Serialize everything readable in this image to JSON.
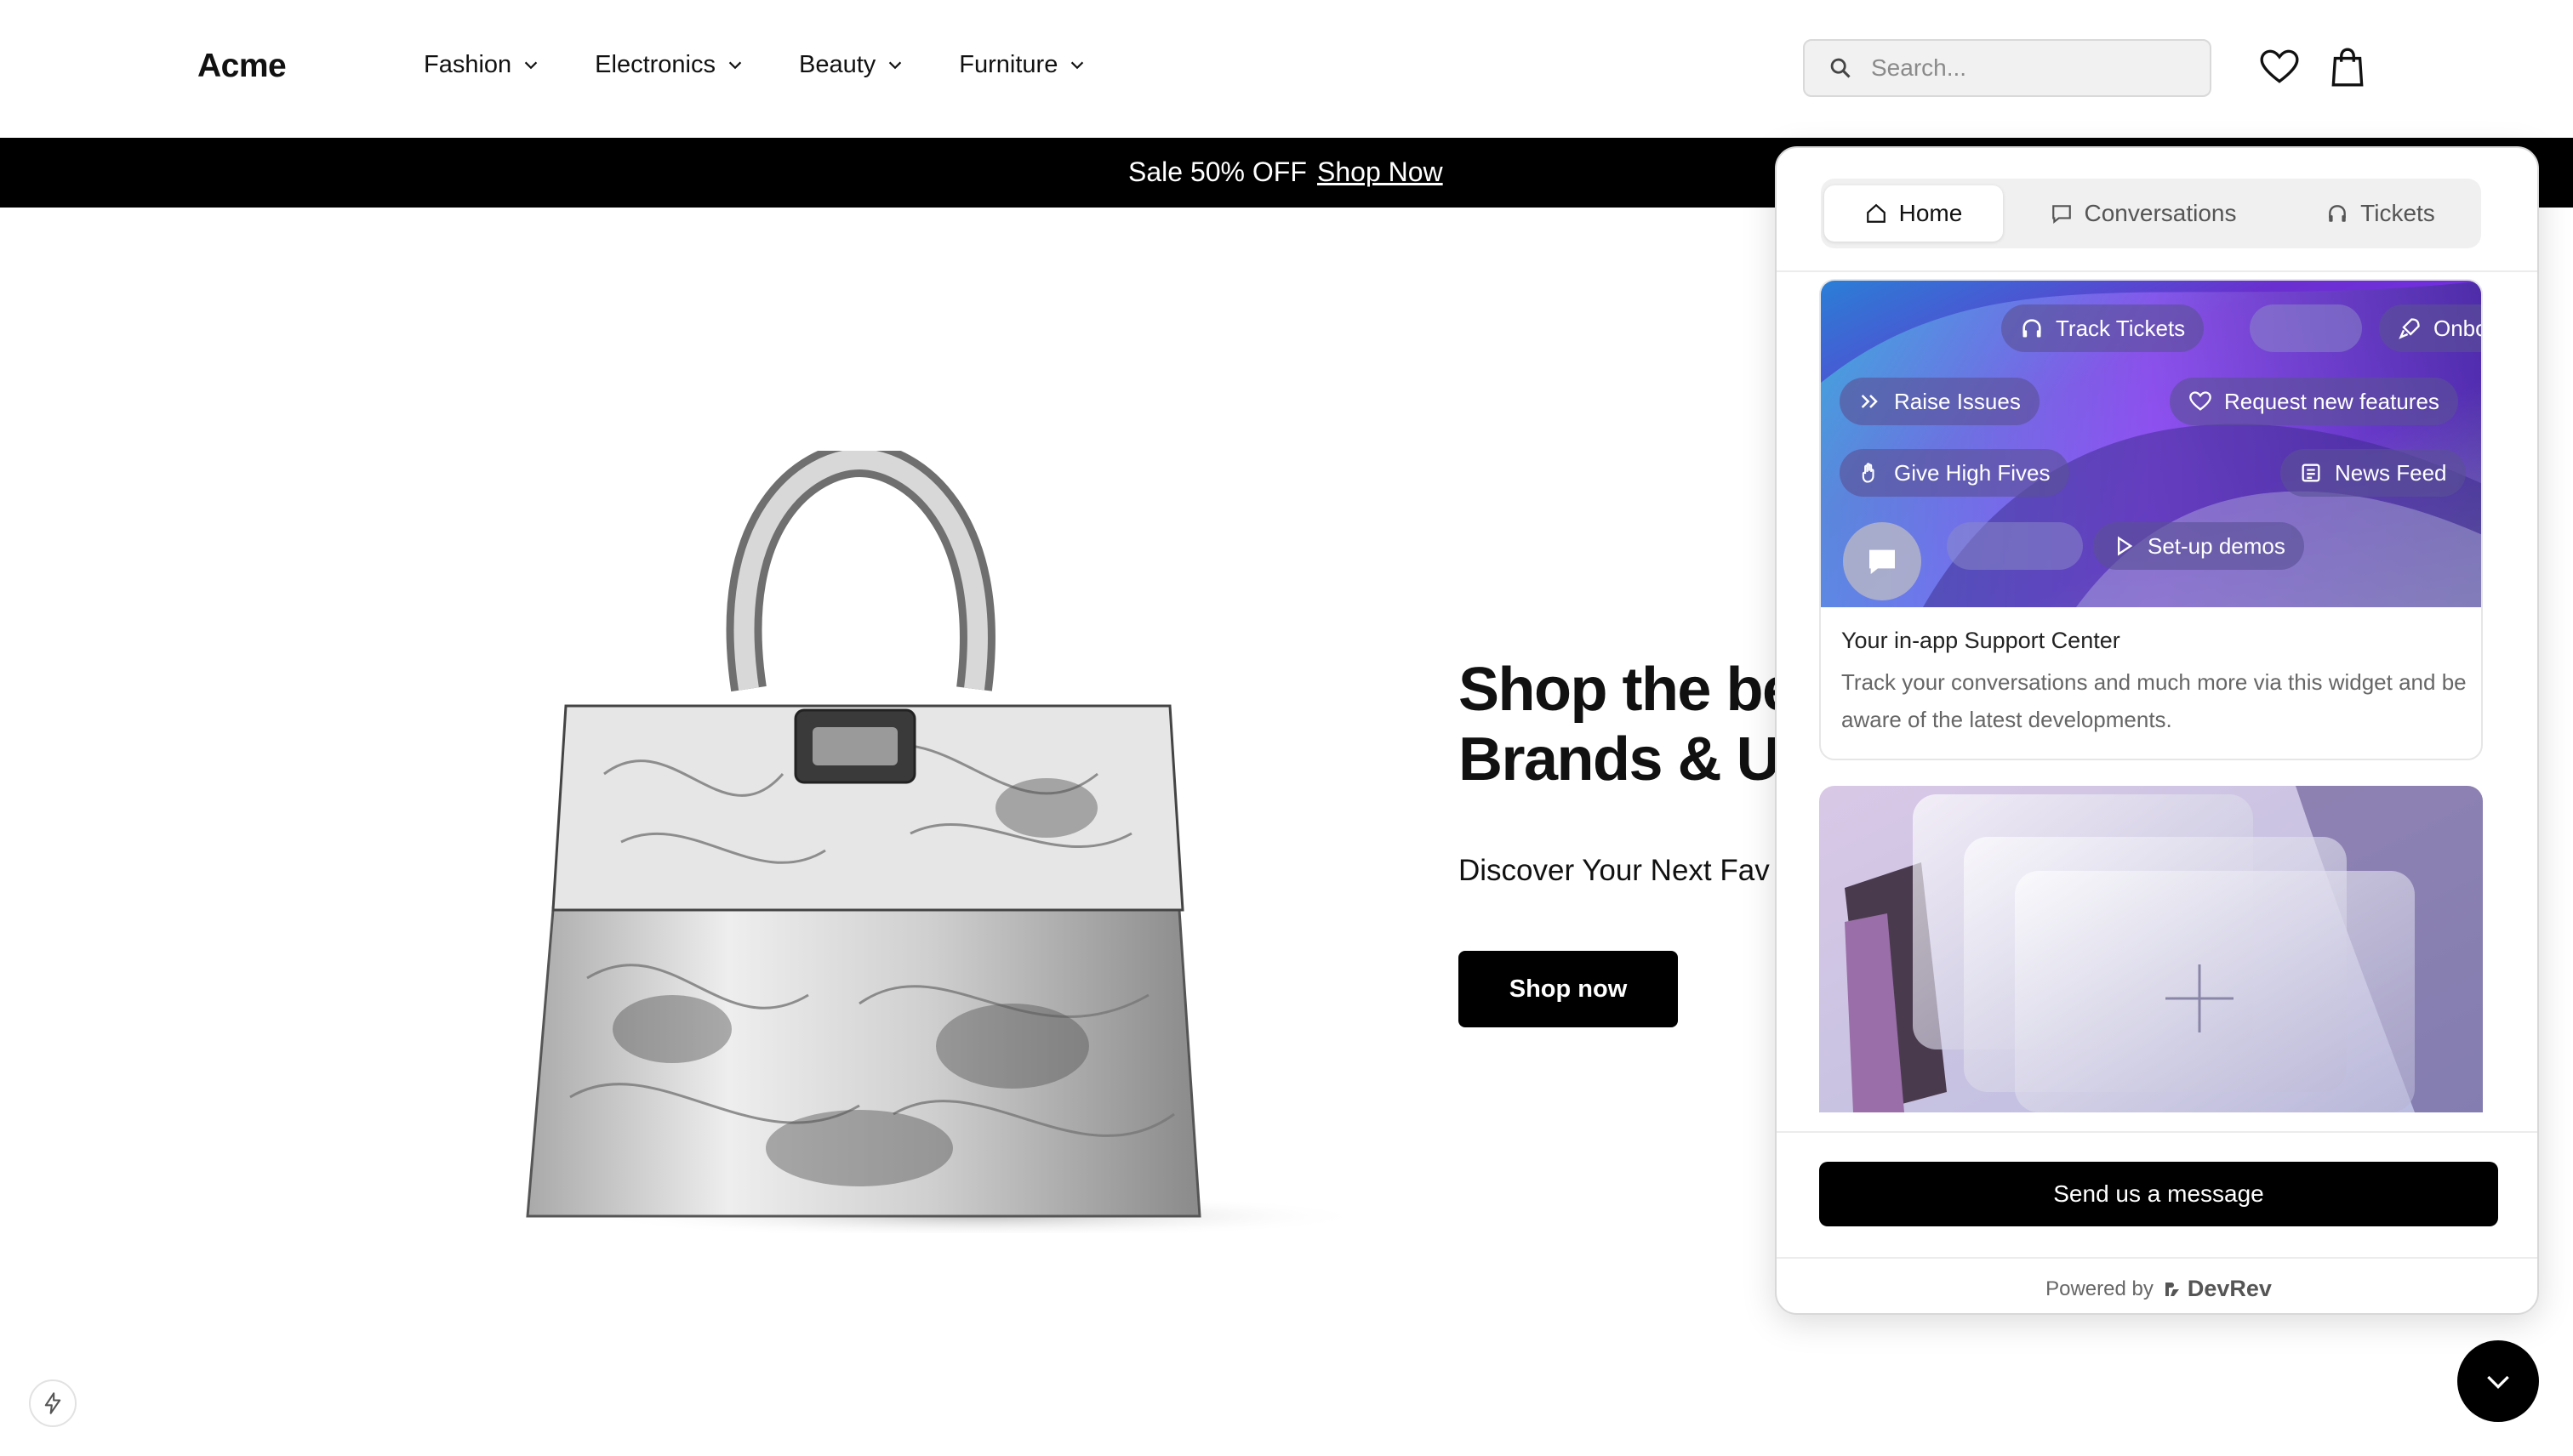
{
  "header": {
    "logo": "Acme",
    "nav": [
      {
        "label": "Fashion"
      },
      {
        "label": "Electronics"
      },
      {
        "label": "Beauty"
      },
      {
        "label": "Furniture"
      }
    ],
    "search_placeholder": "Search...",
    "icons": [
      "search-icon",
      "heart-icon",
      "shopping-bag-icon"
    ]
  },
  "promo": {
    "text": "Sale 50% OFF",
    "link": "Shop Now"
  },
  "hero": {
    "title_line1": "Shop the be",
    "title_line2": "Brands & Ur",
    "subtitle": "Discover Your Next Fav",
    "button": "Shop now"
  },
  "widget": {
    "tabs": [
      {
        "label": "Home",
        "icon": "home-icon",
        "active": true
      },
      {
        "label": "Conversations",
        "icon": "chat-icon",
        "active": false
      },
      {
        "label": "Tickets",
        "icon": "headphones-icon",
        "active": false
      }
    ],
    "pills": {
      "track": "Track Tickets",
      "onboard": "Onbo",
      "raise": "Raise Issues",
      "request": "Request new features",
      "highfive": "Give High Fives",
      "news": "News Feed",
      "demos": "Set-up demos"
    },
    "card_title": "Your in-app Support Center",
    "card_desc": "Track your conversations and much more via this widget and be aware of the latest developments.",
    "send_button": "Send us a message",
    "powered_by": "Powered by",
    "brand": "DevRev"
  },
  "colors": {
    "promo_bg": "#000000",
    "pill_bg": "#5a5096",
    "widget_accent": "#7a3cff"
  }
}
